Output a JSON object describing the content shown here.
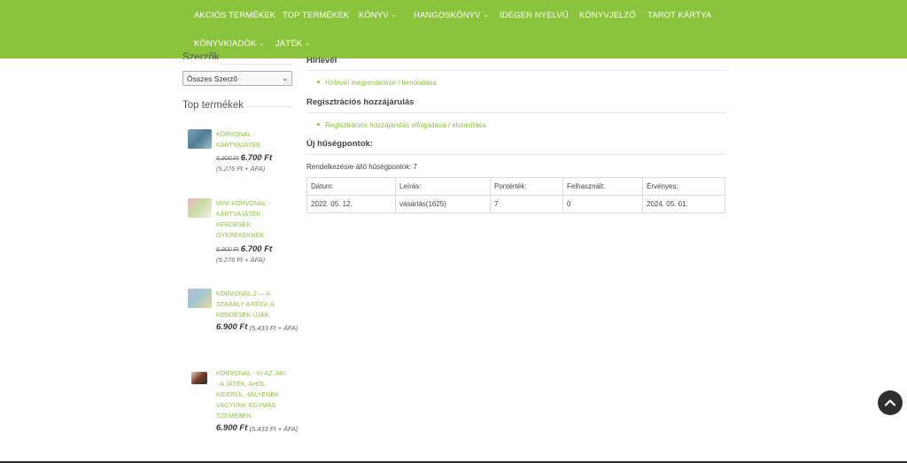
{
  "nav": {
    "items": [
      {
        "label": "AKCIÓS TERMÉKEK",
        "dropdown": false
      },
      {
        "label": "TOP TERMÉKEK",
        "dropdown": false
      },
      {
        "label": "KÖNYV",
        "dropdown": true
      },
      {
        "label": "HANGOSKÖNYV",
        "dropdown": true
      },
      {
        "label": "IDEGEN NYELVŰ",
        "dropdown": false
      },
      {
        "label": "KÖNYVJELZŐ",
        "dropdown": false
      },
      {
        "label": "TAROT KÁRTYA",
        "dropdown": false
      },
      {
        "label": "KÖNYVKIADÓK",
        "dropdown": true
      },
      {
        "label": "JÁTÉK",
        "dropdown": true
      }
    ],
    "chevron": "⌄"
  },
  "sidebar": {
    "authors_title": "Szerzők",
    "authors_select_value": "Összes Szerző",
    "top_products_title": "Top termékek",
    "products": [
      {
        "name": "KÖRVONAL - KÁRTYAJÁTÉK",
        "old_price": "6.900 Ft",
        "price": "6.700 Ft",
        "vat": "(5.276 Ft + ÁFA)"
      },
      {
        "name": "MINI KÖRVONAL - KÁRTYAJÁTÉK - KÉRDÉSEK GYEREKEKNEK",
        "old_price": "6.900 Ft",
        "price": "6.700 Ft",
        "vat": "(5.276 Ft + ÁFA)"
      },
      {
        "name": "KÖRVONAL 2 — A SZABÁLY A RÉGI, A KÉRDÉSEK ÚJAK.",
        "old_price": "",
        "price": "6.900 Ft",
        "vat": "(5.433 Ft + ÁFA)"
      },
      {
        "name": "KÖRVONAL - KI AZ, AKI - A JÁTÉK, AHOL KIDERÜL, MILYENEK VAGYUNK EGYMÁS SZEMÉBEN.",
        "old_price": "",
        "price": "6.900 Ft",
        "vat": "(5.433 Ft + ÁFA)"
      }
    ]
  },
  "main": {
    "newsletter": {
      "title": "Hírlevél",
      "link": "Hírlevél megrendelése / lemondása"
    },
    "consent": {
      "title": "Regisztrációs hozzájárulás",
      "link": "Regisztrációs hozzájárulás elfogadása / elutasítása"
    },
    "loyalty": {
      "title": "Új hűségpontok:",
      "available_text": "Rendelkezésre álló hűségpontok: 7",
      "table": {
        "headers": [
          "Dátum:",
          "Leírás:",
          "Pontérték:",
          "Felhasznált:",
          "Érvényes:"
        ],
        "rows": [
          [
            "2022. 05. 12.",
            "vásárlás(1625)",
            "7",
            "0",
            "2024. 05. 01."
          ]
        ]
      }
    }
  },
  "colors": {
    "brand_green": "#8bc43c",
    "scroll_button": "#2f2f2f"
  },
  "icons": {
    "scroll_top": "chevron-up-icon"
  }
}
